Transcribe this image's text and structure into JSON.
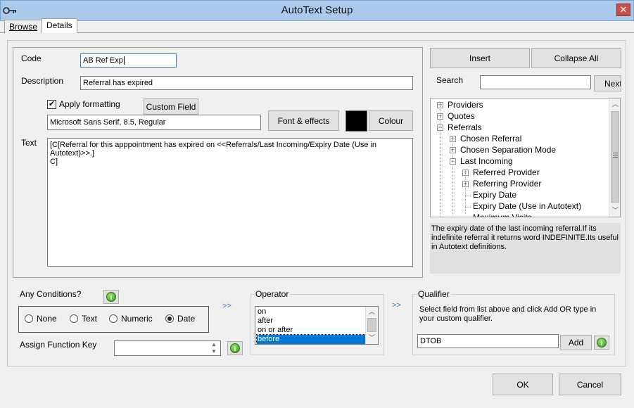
{
  "window": {
    "title": "AutoText Setup",
    "close_glyph": "✕"
  },
  "tabs": [
    {
      "label": "Browse"
    },
    {
      "label": "Details"
    }
  ],
  "form": {
    "code_label": "Code",
    "code_value": "AB Ref Exp",
    "description_label": "Description",
    "description_value": "Referral has expired",
    "apply_formatting_label": "Apply formatting",
    "apply_formatting_checked": true,
    "custom_field_label": "Custom Field",
    "font_value": "Microsoft Sans Serif, 8.5, Regular",
    "font_effects_label": "Font & effects",
    "colour_label": "Colour",
    "colour_swatch": "#000000",
    "text_label": "Text",
    "text_value_line1": "[C[Referral for this apppointment has expired on <<Referrals/Last Incoming/Expiry Date (Use in Autotext)>>.]",
    "text_value_line2": "C]"
  },
  "right_panel": {
    "insert_label": "Insert",
    "collapse_all_label": "Collapse All",
    "search_label": "Search",
    "search_value": "",
    "next_label": "Next",
    "tree": [
      {
        "label": "Providers",
        "level": 0,
        "expander": "+"
      },
      {
        "label": "Quotes",
        "level": 0,
        "expander": "+"
      },
      {
        "label": "Referrals",
        "level": 0,
        "expander": "-"
      },
      {
        "label": "Chosen Referral",
        "level": 1,
        "expander": "+"
      },
      {
        "label": "Chosen Separation Mode",
        "level": 1,
        "expander": "+"
      },
      {
        "label": "Last Incoming",
        "level": 1,
        "expander": "-"
      },
      {
        "label": "Referred Provider",
        "level": 2,
        "expander": "+"
      },
      {
        "label": "Referring Provider",
        "level": 2,
        "expander": "+"
      },
      {
        "label": "Expiry Date",
        "level": 2,
        "expander": ""
      },
      {
        "label": "Expiry Date (Use in Autotext)",
        "level": 2,
        "expander": ""
      },
      {
        "label": "Maximum Visits",
        "level": 2,
        "expander": ""
      }
    ],
    "description": "The expiry date of the last incoming referral.If its indefinite referral it returns word INDEFINITE.Its useful in Autotext definitions."
  },
  "conditions": {
    "label": "Any Conditions?",
    "options": [
      {
        "label": "None",
        "selected": false
      },
      {
        "label": "Text",
        "selected": false
      },
      {
        "label": "Numeric",
        "selected": false
      },
      {
        "label": "Date",
        "selected": true
      }
    ],
    "assign_key_label": "Assign Function Key",
    "assign_key_value": "",
    "arrows": ">>"
  },
  "operator": {
    "label": "Operator",
    "items": [
      {
        "label": "on",
        "selected": false
      },
      {
        "label": "after",
        "selected": false
      },
      {
        "label": "on or after",
        "selected": false
      },
      {
        "label": "before",
        "selected": true
      }
    ]
  },
  "qualifier": {
    "label": "Qualifier",
    "hint": "Select field from list above and click Add OR type in your custom qualifier.",
    "value": "DTOB",
    "add_label": "Add"
  },
  "footer": {
    "ok_label": "OK",
    "cancel_label": "Cancel"
  },
  "icons": {
    "app": "key-icon",
    "info": "info-icon",
    "info_glyph": "i"
  }
}
